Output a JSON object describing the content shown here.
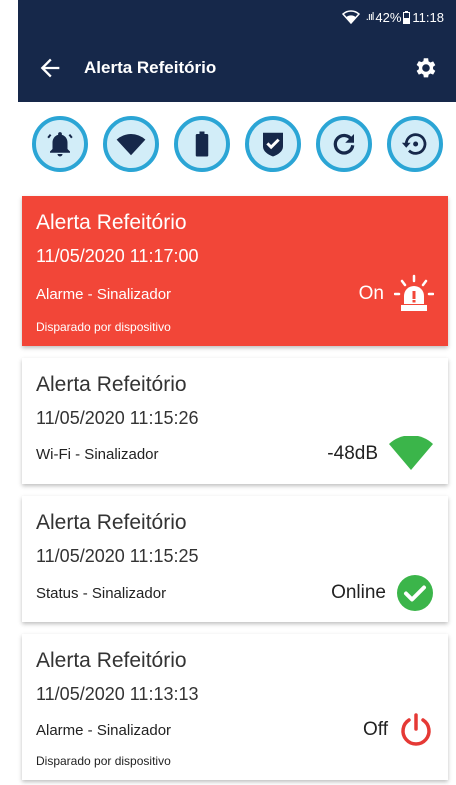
{
  "status_bar": {
    "battery": "42%",
    "time": "11:18"
  },
  "app_bar": {
    "title": "Alerta Refeitório"
  },
  "toolbar_icons": [
    "bell-alert-icon",
    "wifi-icon",
    "battery-icon",
    "shield-check-icon",
    "refresh-icon",
    "history-icon"
  ],
  "colors": {
    "appbar": "#16284a",
    "accent": "#2ba5d5",
    "alarm": "#f24638",
    "ok": "#3bb54a",
    "off": "#e53935"
  },
  "cards": [
    {
      "title": "Alerta Refeitório",
      "datetime": "11/05/2020  11:17:00",
      "label": "Alarme - Sinalizador",
      "value": "On",
      "sub": "Disparado por dispositivo",
      "icon": "siren-icon"
    },
    {
      "title": "Alerta Refeitório",
      "datetime": "11/05/2020  11:15:26",
      "label": "Wi-Fi - Sinalizador",
      "value": "-48dB",
      "icon": "wifi-signal-icon"
    },
    {
      "title": "Alerta Refeitório",
      "datetime": "11/05/2020  11:15:25",
      "label": "Status - Sinalizador",
      "value": "Online",
      "icon": "check-circle-icon"
    },
    {
      "title": "Alerta Refeitório",
      "datetime": "11/05/2020  11:13:13",
      "label": "Alarme - Sinalizador",
      "value": "Off",
      "sub": "Disparado por dispositivo",
      "icon": "power-icon"
    }
  ]
}
